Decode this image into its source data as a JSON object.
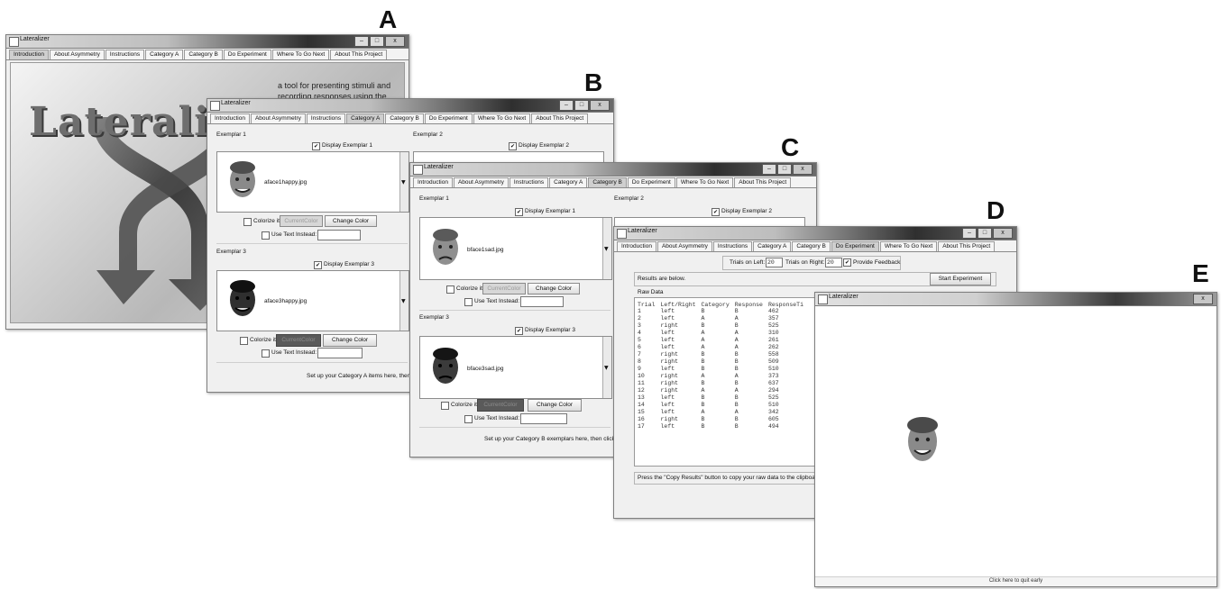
{
  "panel_letters": {
    "a": "A",
    "b": "B",
    "c": "C",
    "d": "D",
    "e": "E"
  },
  "app_title": "Lateralizer",
  "tabs": [
    "Introduction",
    "About Asymmetry",
    "Instructions",
    "Category A",
    "Category B",
    "Do Experiment",
    "Where To Go Next",
    "About This Project"
  ],
  "window_buttons": {
    "min": "–",
    "max": "□",
    "close": "x"
  },
  "intro": {
    "logo_text": "Lateralizer",
    "tagline_1": "a tool for presenting stimuli and",
    "tagline_2": "recording responses using the"
  },
  "category_a": {
    "ex1_label": "Exemplar 1",
    "ex1_display": "Display Exemplar 1",
    "ex2_label": "Exemplar 2",
    "ex2_display": "Display Exemplar 2",
    "ex1_file": "aface1happy.jpg",
    "ex3_label": "Exemplar 3",
    "ex3_display": "Display Exemplar 3",
    "ex3_file": "aface3happy.jpg",
    "colorize": "Colorize it",
    "current_color": "CurrentColor",
    "change_color": "Change Color",
    "use_text": "Use Text Instead:",
    "footer": "Set up your Category A items here, then c"
  },
  "category_b": {
    "ex1_label": "Exemplar 1",
    "ex1_display": "Display Exemplar 1",
    "ex2_label": "Exemplar 2",
    "ex2_display": "Display Exemplar 2",
    "ex1_file": "bface1sad.jpg",
    "ex3_label": "Exemplar 3",
    "ex3_display": "Display Exemplar 3",
    "ex3_file": "bface3sad.jpg",
    "colorize": "Colorize it",
    "current_color": "CurrentColor",
    "change_color": "Change Color",
    "use_text": "Use Text Instead:",
    "footer": "Set up your Category B exemplars here, then click t"
  },
  "experiment": {
    "trials_left_label": "Trials on Left:",
    "trials_left_value": "20",
    "trials_right_label": "Trials on Right:",
    "trials_right_value": "20",
    "provide_feedback": "Provide Feedback",
    "results_text": "Results are below.",
    "start_button": "Start Experiment",
    "raw_data_label": "Raw Data",
    "columns": [
      "Trial",
      "Left/Right",
      "Category",
      "Response",
      "ResponseTi"
    ],
    "rows": [
      [
        "1",
        "left",
        "B",
        "B",
        "462"
      ],
      [
        "2",
        "left",
        "A",
        "A",
        "357"
      ],
      [
        "3",
        "right",
        "B",
        "B",
        "525"
      ],
      [
        "4",
        "left",
        "A",
        "A",
        "310"
      ],
      [
        "5",
        "left",
        "A",
        "A",
        "261"
      ],
      [
        "6",
        "left",
        "A",
        "A",
        "262"
      ],
      [
        "7",
        "right",
        "B",
        "B",
        "558"
      ],
      [
        "8",
        "right",
        "B",
        "B",
        "509"
      ],
      [
        "9",
        "left",
        "B",
        "B",
        "510"
      ],
      [
        "10",
        "right",
        "A",
        "A",
        "373"
      ],
      [
        "11",
        "right",
        "B",
        "B",
        "637"
      ],
      [
        "12",
        "right",
        "A",
        "A",
        "294"
      ],
      [
        "13",
        "left",
        "B",
        "B",
        "525"
      ],
      [
        "14",
        "left",
        "B",
        "B",
        "510"
      ],
      [
        "15",
        "left",
        "A",
        "A",
        "342"
      ],
      [
        "16",
        "right",
        "B",
        "B",
        "605"
      ],
      [
        "17",
        "left",
        "B",
        "B",
        "494"
      ]
    ],
    "copy_hint": "Press the \"Copy Results\" button to copy your raw data to the clipboard."
  },
  "stimulus": {
    "quit_text": "Click here to quit early"
  }
}
